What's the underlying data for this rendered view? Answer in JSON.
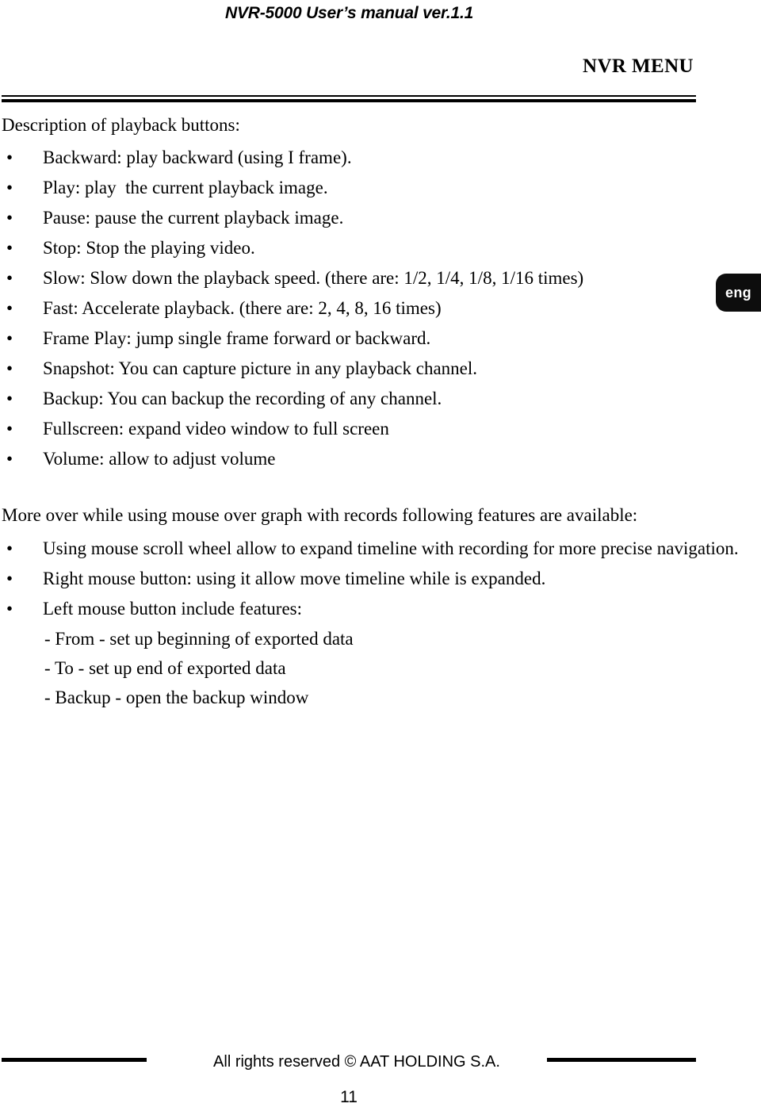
{
  "header": {
    "running_head": "NVR-5000 User’s manual ver.1.1",
    "section_title": "NVR MENU"
  },
  "lang_tab": {
    "label": "eng",
    "background_color": "#0d0d0d",
    "text_color": "#ffffff"
  },
  "body": {
    "intro_1": "Description of playback buttons:",
    "playback_buttons": [
      {
        "bullet": "•",
        "text": "Backward: play backward (using I frame)."
      },
      {
        "bullet": "•",
        "text": "Play: play  the current playback image."
      },
      {
        "bullet": "•",
        "text": "Pause: pause the current playback image."
      },
      {
        "bullet": "•",
        "text": "Stop: Stop the playing video."
      },
      {
        "bullet": "•",
        "text": "Slow: Slow down the playback speed. (there are: 1/2, 1/4, 1/8, 1/16 times)"
      },
      {
        "bullet": "•",
        "text": "Fast: Accelerate playback. (there are: 2, 4, 8, 16 times)"
      },
      {
        "bullet": "•",
        "text": "Frame Play: jump single frame forward or backward."
      },
      {
        "bullet": "•",
        "text": "Snapshot: You can capture picture in any playback channel."
      },
      {
        "bullet": "•",
        "text": "Backup: You can backup the recording of any channel."
      },
      {
        "bullet": "•",
        "text": "Fullscreen: expand video window to full screen"
      },
      {
        "bullet": "•",
        "text": "Volume: allow to adjust volume"
      }
    ],
    "intro_2": "More over while using mouse over graph with records following features are available:",
    "mouse_features": [
      {
        "bullet": "•",
        "text": "Using mouse scroll wheel allow to expand timeline with recording for more precise navigation."
      },
      {
        "bullet": "•",
        "text": "Right mouse button: using it allow move timeline while is expanded."
      },
      {
        "bullet": "•",
        "text": "Left mouse button include features:"
      }
    ],
    "mouse_subitems": [
      "- From - set up beginning of exported data",
      "- To - set up end of exported data",
      "- Backup - open the backup window"
    ]
  },
  "footer": {
    "copyright": "All rights reserved © AAT HOLDING S.A.",
    "page_number": "11"
  }
}
